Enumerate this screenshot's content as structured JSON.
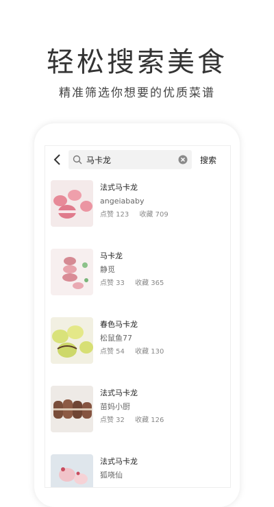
{
  "headline": "轻松搜索美食",
  "subheadline": "精准筛选你想要的优质菜谱",
  "search": {
    "query": "马卡龙",
    "button_label": "搜索"
  },
  "results": [
    {
      "title": "法式马卡龙",
      "author": "angeiababy",
      "likes": "点赞 123",
      "favorites": "收藏 709"
    },
    {
      "title": "马卡龙",
      "author": "静觅",
      "likes": "点赞 33",
      "favorites": "收藏 365"
    },
    {
      "title": "春色马卡龙",
      "author": "松鼠鱼77",
      "likes": "点赞 54",
      "favorites": "收藏 130"
    },
    {
      "title": "法式马卡龙",
      "author": "苗妈小厨",
      "likes": "点赞 32",
      "favorites": "收藏 126"
    },
    {
      "title": "法式马卡龙",
      "author": "狐哓仙",
      "likes": "",
      "favorites": ""
    }
  ],
  "colors": {
    "text_primary": "#222222",
    "text_secondary": "#888888",
    "search_bg": "#f2f2f2"
  },
  "icons": {
    "back": "chevron-left-icon",
    "search": "search-icon",
    "clear": "clear-icon"
  }
}
